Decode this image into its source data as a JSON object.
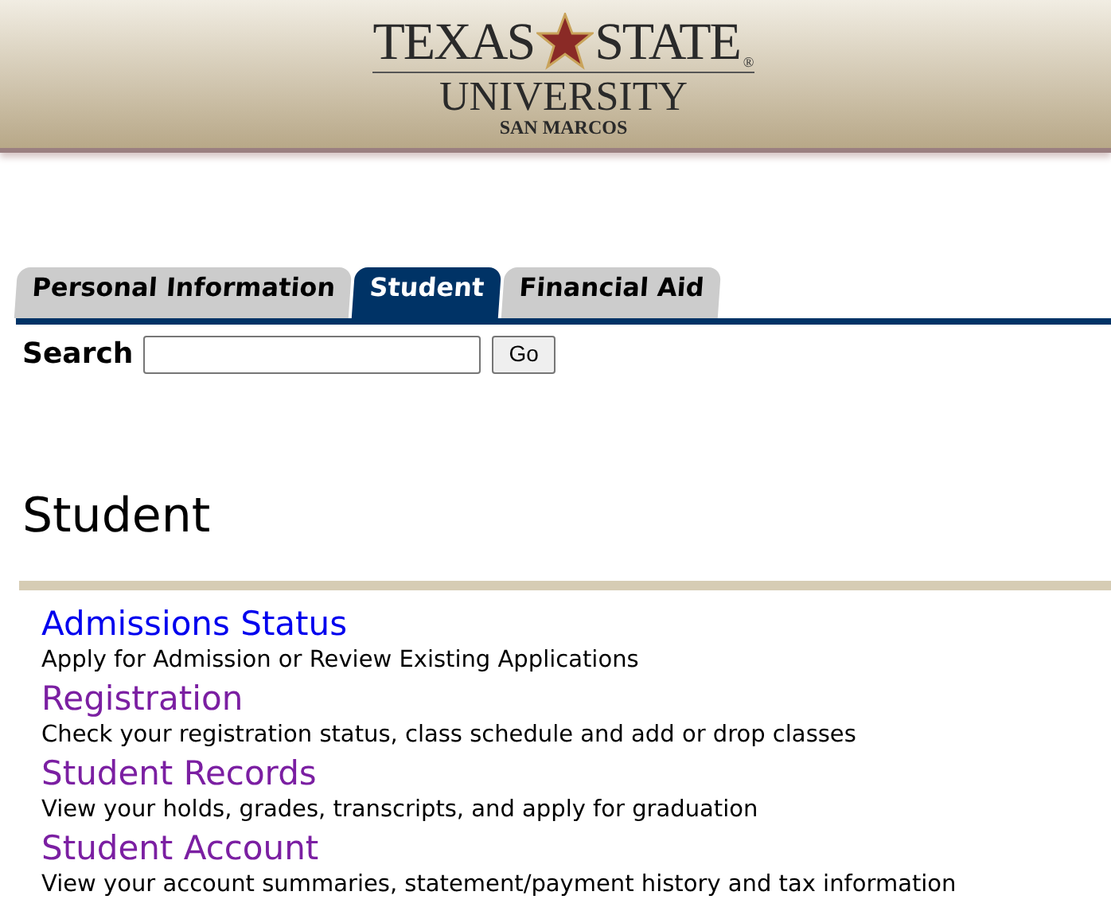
{
  "logo": {
    "word_1": "TEXAS",
    "word_2": "STATE",
    "line_2": "UNIVERSITY",
    "line_3": "SAN MARCOS",
    "mark": "®"
  },
  "tabs": [
    {
      "label": "Personal Information",
      "selected": false
    },
    {
      "label": "Student",
      "selected": true
    },
    {
      "label": "Financial Aid",
      "selected": false
    }
  ],
  "search": {
    "label": "Search",
    "button": "Go"
  },
  "heading": "Student",
  "menu": [
    {
      "title": "Admissions Status",
      "visited": false,
      "description": "Apply for Admission or Review Existing Applications"
    },
    {
      "title": "Registration",
      "visited": true,
      "description": "Check your registration status, class schedule and add or drop classes"
    },
    {
      "title": "Student Records",
      "visited": true,
      "description": "View your holds, grades, transcripts, and apply for graduation"
    },
    {
      "title": "Student Account",
      "visited": true,
      "description": "View your account summaries, statement/payment history and tax information"
    }
  ]
}
